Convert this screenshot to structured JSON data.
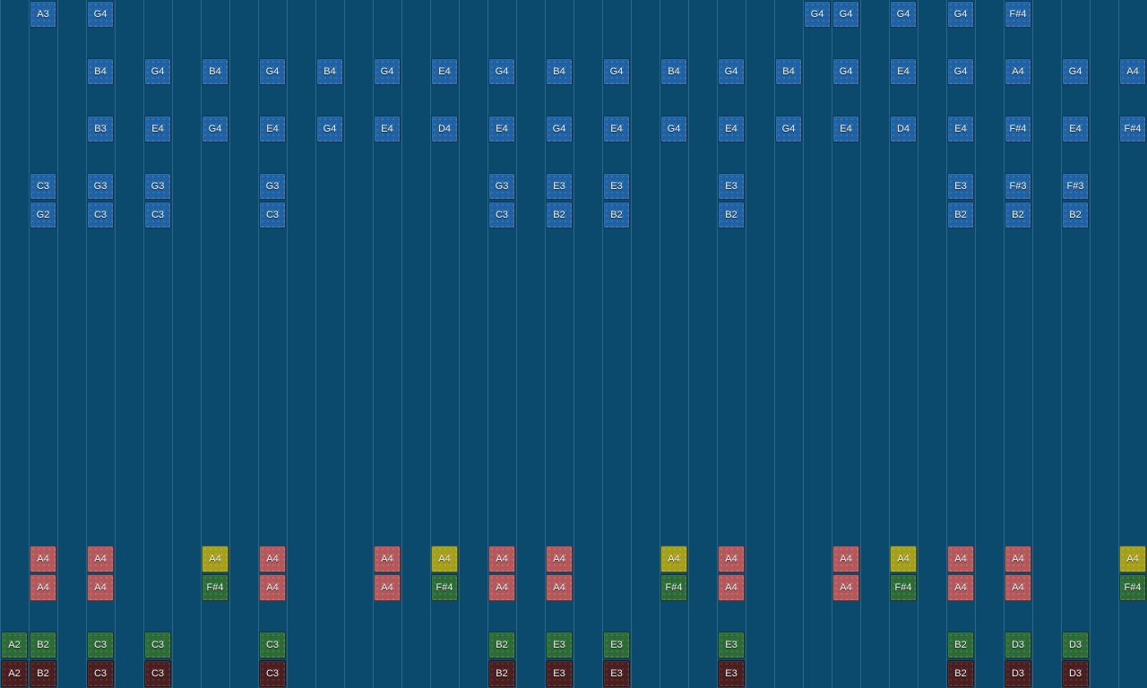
{
  "piano_roll": {
    "colors": {
      "background": "#0b4a6c",
      "blue": "#1f62a3",
      "red": "#b4585b",
      "yellow": "#a4a018",
      "green": "#2d6b36",
      "brown": "#4a1f1f"
    },
    "notes": [
      {
        "col": 1,
        "row": 0,
        "label": "A3",
        "kind": "blue"
      },
      {
        "col": 3,
        "row": 0,
        "label": "G4",
        "kind": "blue"
      },
      {
        "col": 28,
        "row": 0,
        "label": "G4",
        "kind": "blue"
      },
      {
        "col": 29,
        "row": 0,
        "label": "G4",
        "kind": "blue"
      },
      {
        "col": 31,
        "row": 0,
        "label": "G4",
        "kind": "blue"
      },
      {
        "col": 33,
        "row": 0,
        "label": "G4",
        "kind": "blue"
      },
      {
        "col": 35,
        "row": 0,
        "label": "F#4",
        "kind": "blue"
      },
      {
        "col": 3,
        "row": 2,
        "label": "B4",
        "kind": "blue"
      },
      {
        "col": 5,
        "row": 2,
        "label": "G4",
        "kind": "blue"
      },
      {
        "col": 7,
        "row": 2,
        "label": "B4",
        "kind": "blue"
      },
      {
        "col": 9,
        "row": 2,
        "label": "G4",
        "kind": "blue"
      },
      {
        "col": 11,
        "row": 2,
        "label": "B4",
        "kind": "blue"
      },
      {
        "col": 13,
        "row": 2,
        "label": "G4",
        "kind": "blue"
      },
      {
        "col": 15,
        "row": 2,
        "label": "E4",
        "kind": "blue"
      },
      {
        "col": 17,
        "row": 2,
        "label": "G4",
        "kind": "blue"
      },
      {
        "col": 19,
        "row": 2,
        "label": "B4",
        "kind": "blue"
      },
      {
        "col": 21,
        "row": 2,
        "label": "G4",
        "kind": "blue"
      },
      {
        "col": 23,
        "row": 2,
        "label": "B4",
        "kind": "blue"
      },
      {
        "col": 25,
        "row": 2,
        "label": "G4",
        "kind": "blue"
      },
      {
        "col": 27,
        "row": 2,
        "label": "B4",
        "kind": "blue"
      },
      {
        "col": 29,
        "row": 2,
        "label": "G4",
        "kind": "blue"
      },
      {
        "col": 31,
        "row": 2,
        "label": "E4",
        "kind": "blue"
      },
      {
        "col": 33,
        "row": 2,
        "label": "G4",
        "kind": "blue"
      },
      {
        "col": 35,
        "row": 2,
        "label": "A4",
        "kind": "blue"
      },
      {
        "col": 37,
        "row": 2,
        "label": "G4",
        "kind": "blue"
      },
      {
        "col": 39,
        "row": 2,
        "label": "A4",
        "kind": "blue"
      },
      {
        "col": 3,
        "row": 4,
        "label": "B3",
        "kind": "blue"
      },
      {
        "col": 5,
        "row": 4,
        "label": "E4",
        "kind": "blue"
      },
      {
        "col": 7,
        "row": 4,
        "label": "G4",
        "kind": "blue"
      },
      {
        "col": 9,
        "row": 4,
        "label": "E4",
        "kind": "blue"
      },
      {
        "col": 11,
        "row": 4,
        "label": "G4",
        "kind": "blue"
      },
      {
        "col": 13,
        "row": 4,
        "label": "E4",
        "kind": "blue"
      },
      {
        "col": 15,
        "row": 4,
        "label": "D4",
        "kind": "blue"
      },
      {
        "col": 17,
        "row": 4,
        "label": "E4",
        "kind": "blue"
      },
      {
        "col": 19,
        "row": 4,
        "label": "G4",
        "kind": "blue"
      },
      {
        "col": 21,
        "row": 4,
        "label": "E4",
        "kind": "blue"
      },
      {
        "col": 23,
        "row": 4,
        "label": "G4",
        "kind": "blue"
      },
      {
        "col": 25,
        "row": 4,
        "label": "E4",
        "kind": "blue"
      },
      {
        "col": 27,
        "row": 4,
        "label": "G4",
        "kind": "blue"
      },
      {
        "col": 29,
        "row": 4,
        "label": "E4",
        "kind": "blue"
      },
      {
        "col": 31,
        "row": 4,
        "label": "D4",
        "kind": "blue"
      },
      {
        "col": 33,
        "row": 4,
        "label": "E4",
        "kind": "blue"
      },
      {
        "col": 35,
        "row": 4,
        "label": "F#4",
        "kind": "blue"
      },
      {
        "col": 37,
        "row": 4,
        "label": "E4",
        "kind": "blue"
      },
      {
        "col": 39,
        "row": 4,
        "label": "F#4",
        "kind": "blue"
      },
      {
        "col": 1,
        "row": 6,
        "label": "C3",
        "kind": "blue"
      },
      {
        "col": 3,
        "row": 6,
        "label": "G3",
        "kind": "blue"
      },
      {
        "col": 5,
        "row": 6,
        "label": "G3",
        "kind": "blue"
      },
      {
        "col": 9,
        "row": 6,
        "label": "G3",
        "kind": "blue"
      },
      {
        "col": 17,
        "row": 6,
        "label": "G3",
        "kind": "blue"
      },
      {
        "col": 19,
        "row": 6,
        "label": "E3",
        "kind": "blue"
      },
      {
        "col": 21,
        "row": 6,
        "label": "E3",
        "kind": "blue"
      },
      {
        "col": 25,
        "row": 6,
        "label": "E3",
        "kind": "blue"
      },
      {
        "col": 33,
        "row": 6,
        "label": "E3",
        "kind": "blue"
      },
      {
        "col": 35,
        "row": 6,
        "label": "F#3",
        "kind": "blue"
      },
      {
        "col": 37,
        "row": 6,
        "label": "F#3",
        "kind": "blue"
      },
      {
        "col": 1,
        "row": 7,
        "label": "G2",
        "kind": "blue"
      },
      {
        "col": 3,
        "row": 7,
        "label": "C3",
        "kind": "blue"
      },
      {
        "col": 5,
        "row": 7,
        "label": "C3",
        "kind": "blue"
      },
      {
        "col": 9,
        "row": 7,
        "label": "C3",
        "kind": "blue"
      },
      {
        "col": 17,
        "row": 7,
        "label": "C3",
        "kind": "blue"
      },
      {
        "col": 19,
        "row": 7,
        "label": "B2",
        "kind": "blue"
      },
      {
        "col": 21,
        "row": 7,
        "label": "B2",
        "kind": "blue"
      },
      {
        "col": 25,
        "row": 7,
        "label": "B2",
        "kind": "blue"
      },
      {
        "col": 33,
        "row": 7,
        "label": "B2",
        "kind": "blue"
      },
      {
        "col": 35,
        "row": 7,
        "label": "B2",
        "kind": "blue"
      },
      {
        "col": 37,
        "row": 7,
        "label": "B2",
        "kind": "blue"
      },
      {
        "col": 1,
        "row": 19,
        "label": "A4",
        "kind": "red"
      },
      {
        "col": 3,
        "row": 19,
        "label": "A4",
        "kind": "red"
      },
      {
        "col": 7,
        "row": 19,
        "label": "A4",
        "kind": "yellow"
      },
      {
        "col": 9,
        "row": 19,
        "label": "A4",
        "kind": "red"
      },
      {
        "col": 13,
        "row": 19,
        "label": "A4",
        "kind": "red"
      },
      {
        "col": 15,
        "row": 19,
        "label": "A4",
        "kind": "yellow"
      },
      {
        "col": 17,
        "row": 19,
        "label": "A4",
        "kind": "red"
      },
      {
        "col": 19,
        "row": 19,
        "label": "A4",
        "kind": "red"
      },
      {
        "col": 23,
        "row": 19,
        "label": "A4",
        "kind": "yellow"
      },
      {
        "col": 25,
        "row": 19,
        "label": "A4",
        "kind": "red"
      },
      {
        "col": 29,
        "row": 19,
        "label": "A4",
        "kind": "red"
      },
      {
        "col": 31,
        "row": 19,
        "label": "A4",
        "kind": "yellow"
      },
      {
        "col": 33,
        "row": 19,
        "label": "A4",
        "kind": "red"
      },
      {
        "col": 35,
        "row": 19,
        "label": "A4",
        "kind": "red"
      },
      {
        "col": 39,
        "row": 19,
        "label": "A4",
        "kind": "yellow"
      },
      {
        "col": 1,
        "row": 20,
        "label": "A4",
        "kind": "red"
      },
      {
        "col": 3,
        "row": 20,
        "label": "A4",
        "kind": "red"
      },
      {
        "col": 7,
        "row": 20,
        "label": "F#4",
        "kind": "green"
      },
      {
        "col": 9,
        "row": 20,
        "label": "A4",
        "kind": "red"
      },
      {
        "col": 13,
        "row": 20,
        "label": "A4",
        "kind": "red"
      },
      {
        "col": 15,
        "row": 20,
        "label": "F#4",
        "kind": "green"
      },
      {
        "col": 17,
        "row": 20,
        "label": "A4",
        "kind": "red"
      },
      {
        "col": 19,
        "row": 20,
        "label": "A4",
        "kind": "red"
      },
      {
        "col": 23,
        "row": 20,
        "label": "F#4",
        "kind": "green"
      },
      {
        "col": 25,
        "row": 20,
        "label": "A4",
        "kind": "red"
      },
      {
        "col": 29,
        "row": 20,
        "label": "A4",
        "kind": "red"
      },
      {
        "col": 31,
        "row": 20,
        "label": "F#4",
        "kind": "green"
      },
      {
        "col": 33,
        "row": 20,
        "label": "A4",
        "kind": "red"
      },
      {
        "col": 35,
        "row": 20,
        "label": "A4",
        "kind": "red"
      },
      {
        "col": 39,
        "row": 20,
        "label": "F#4",
        "kind": "green"
      },
      {
        "col": 0,
        "row": 22,
        "label": "A2",
        "kind": "green"
      },
      {
        "col": 1,
        "row": 22,
        "label": "B2",
        "kind": "green"
      },
      {
        "col": 3,
        "row": 22,
        "label": "C3",
        "kind": "green"
      },
      {
        "col": 5,
        "row": 22,
        "label": "C3",
        "kind": "green"
      },
      {
        "col": 9,
        "row": 22,
        "label": "C3",
        "kind": "green"
      },
      {
        "col": 17,
        "row": 22,
        "label": "B2",
        "kind": "green"
      },
      {
        "col": 19,
        "row": 22,
        "label": "E3",
        "kind": "green"
      },
      {
        "col": 21,
        "row": 22,
        "label": "E3",
        "kind": "green"
      },
      {
        "col": 25,
        "row": 22,
        "label": "E3",
        "kind": "green"
      },
      {
        "col": 33,
        "row": 22,
        "label": "B2",
        "kind": "green"
      },
      {
        "col": 35,
        "row": 22,
        "label": "D3",
        "kind": "green"
      },
      {
        "col": 37,
        "row": 22,
        "label": "D3",
        "kind": "green"
      },
      {
        "col": 0,
        "row": 23,
        "label": "A2",
        "kind": "brown"
      },
      {
        "col": 1,
        "row": 23,
        "label": "B2",
        "kind": "brown"
      },
      {
        "col": 3,
        "row": 23,
        "label": "C3",
        "kind": "brown"
      },
      {
        "col": 5,
        "row": 23,
        "label": "C3",
        "kind": "brown"
      },
      {
        "col": 9,
        "row": 23,
        "label": "C3",
        "kind": "brown"
      },
      {
        "col": 17,
        "row": 23,
        "label": "B2",
        "kind": "brown"
      },
      {
        "col": 19,
        "row": 23,
        "label": "E3",
        "kind": "brown"
      },
      {
        "col": 21,
        "row": 23,
        "label": "E3",
        "kind": "brown"
      },
      {
        "col": 25,
        "row": 23,
        "label": "E3",
        "kind": "brown"
      },
      {
        "col": 33,
        "row": 23,
        "label": "B2",
        "kind": "brown"
      },
      {
        "col": 35,
        "row": 23,
        "label": "D3",
        "kind": "brown"
      },
      {
        "col": 37,
        "row": 23,
        "label": "D3",
        "kind": "brown"
      }
    ]
  }
}
